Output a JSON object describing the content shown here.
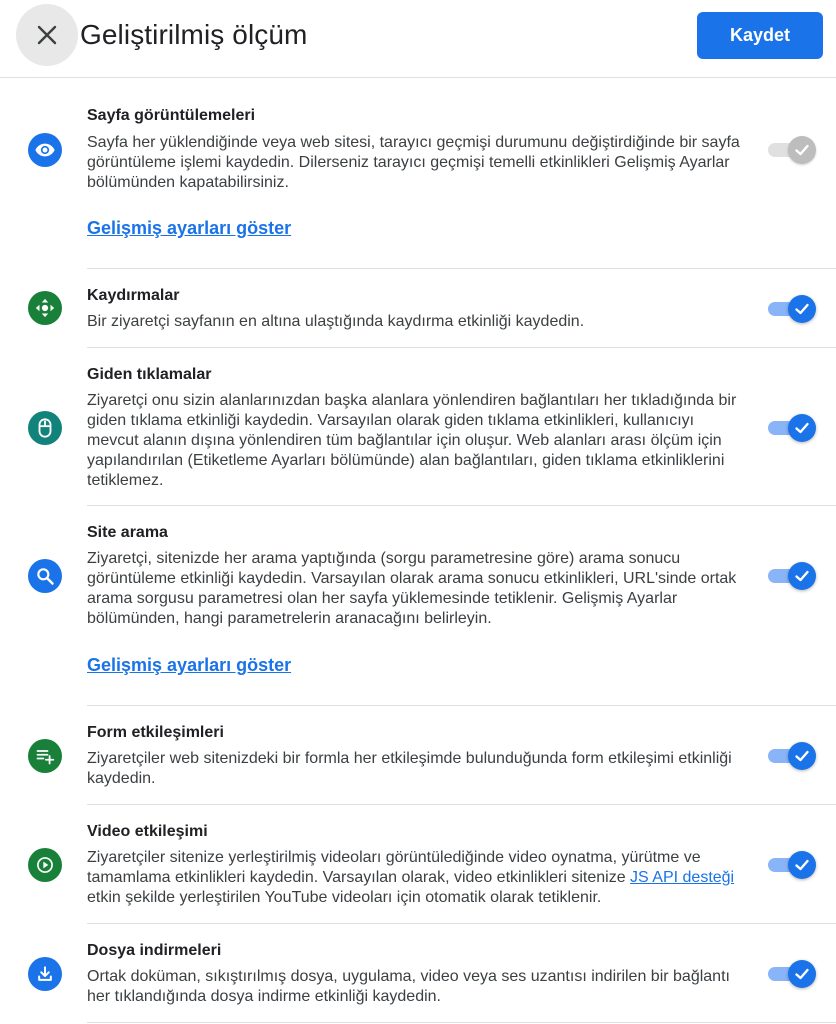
{
  "header": {
    "title": "Geliştirilmiş ölçüm",
    "save_label": "Kaydet"
  },
  "items": [
    {
      "title": "Sayfa görüntülemeleri",
      "desc": "Sayfa her yüklendiğinde veya web sitesi, tarayıcı geçmişi durumunu değiştirdiğinde bir sayfa görüntüleme işlemi kaydedin. Dilerseniz tarayıcı geçmişi temelli etkinlikleri Gelişmiş Ayarlar bölümünden kapatabilirsiniz.",
      "link": "Gelişmiş ayarları göster",
      "icon": "eye-icon",
      "enabled": true,
      "locked": true
    },
    {
      "title": "Kaydırmalar",
      "desc": "Bir ziyaretçi sayfanın en altına ulaştığında kaydırma etkinliği kaydedin.",
      "icon": "scroll-arrows-icon",
      "enabled": true
    },
    {
      "title": "Giden tıklamalar",
      "desc": "Ziyaretçi onu sizin alanlarınızdan başka alanlara yönlendiren bağlantıları her tıkladığında bir giden tıklama etkinliği kaydedin. Varsayılan olarak giden tıklama etkinlikleri, kullanıcıyı mevcut alanın dışına yönlendiren tüm bağlantılar için oluşur. Web alanları arası ölçüm için yapılandırılan (Etiketleme Ayarları bölümünde) alan bağlantıları, giden tıklama etkinliklerini tetiklemez.",
      "icon": "mouse-icon",
      "enabled": true
    },
    {
      "title": "Site arama",
      "desc": "Ziyaretçi, sitenizde her arama yaptığında (sorgu parametresine göre) arama sonucu görüntüleme etkinliği kaydedin. Varsayılan olarak arama sonucu etkinlikleri, URL'sinde ortak arama sorgusu parametresi olan her sayfa yüklemesinde tetiklenir. Gelişmiş Ayarlar bölümünden, hangi parametrelerin aranacağını belirleyin.",
      "link": "Gelişmiş ayarları göster",
      "icon": "search-icon",
      "enabled": true
    },
    {
      "title": "Form etkileşimleri",
      "desc": "Ziyaretçiler web sitenizdeki bir formla her etkileşimde bulunduğunda form etkileşimi etkinliği kaydedin.",
      "icon": "playlist-add-icon",
      "enabled": true
    },
    {
      "title": "Video etkileşimi",
      "desc_before": "Ziyaretçiler sitenize yerleştirilmiş videoları görüntülediğinde video oynatma, yürütme ve tamamlama etkinlikleri kaydedin. Varsayılan olarak, video etkinlikleri sitenize ",
      "desc_link": "JS API desteği",
      "desc_after": " etkin şekilde yerleştirilen YouTube videoları için otomatik olarak tetiklenir.",
      "icon": "play-icon",
      "enabled": true
    },
    {
      "title": "Dosya indirmeleri",
      "desc": "Ortak doküman, sıkıştırılmış dosya, uygulama, video veya ses uzantısı indirilen bir bağlantı her tıklandığında dosya indirme etkinliği kaydedin.",
      "icon": "download-icon",
      "enabled": true
    }
  ],
  "colors": {
    "accent": "#1a73e8",
    "green": "#188038",
    "teal": "#12837a"
  }
}
